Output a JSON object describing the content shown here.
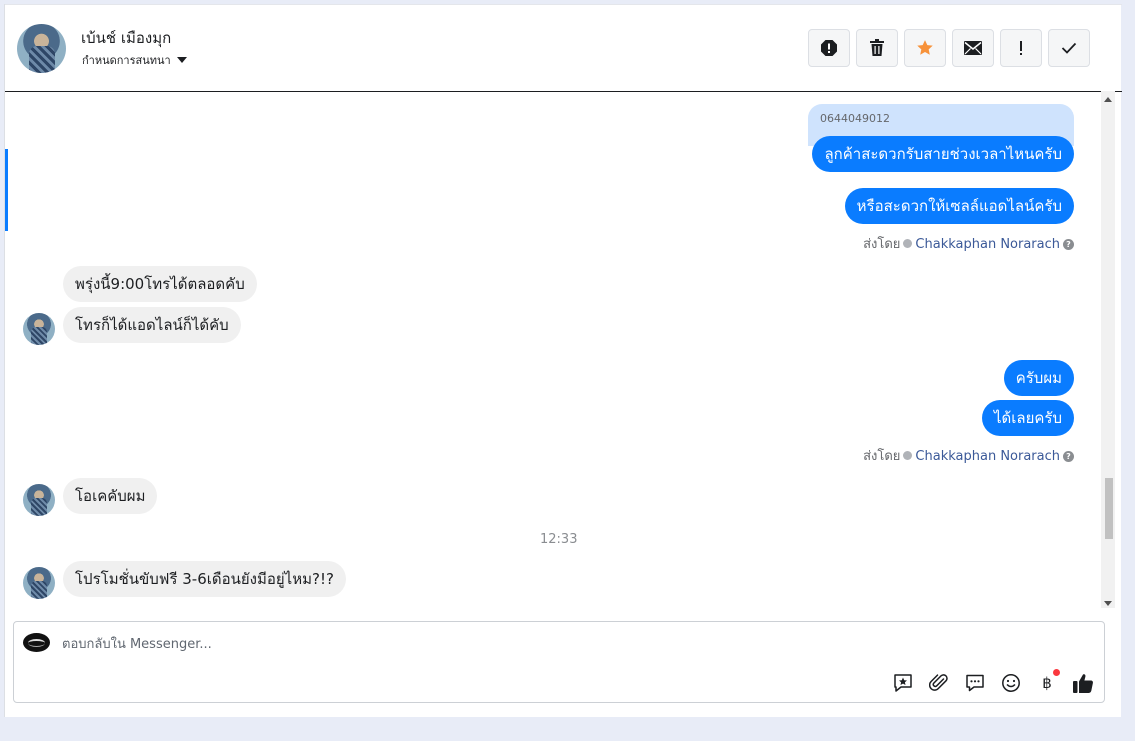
{
  "header": {
    "contact_name": "เบ้นช์ เมืองมุก",
    "assign_label": "กำหนดการสนทนา",
    "actions": [
      {
        "name": "spam-icon"
      },
      {
        "name": "trash-icon"
      },
      {
        "name": "star-icon",
        "color": "#f7923a"
      },
      {
        "name": "mail-icon"
      },
      {
        "name": "follow-up-icon"
      },
      {
        "name": "check-icon"
      }
    ]
  },
  "messages": {
    "quoted_phone": "0644049012",
    "out_1": "ลูกค้าสะดวกรับสายช่วงเวลาไหนครับ",
    "out_2": "หรือสะดวกให้เซลล์แอดไลน์ครับ",
    "sent_by_label_1": "ส่งโดย",
    "agent_1": "Chakkaphan Norarach",
    "in_1": "พรุ่งนี้9:00โทรได้ตลอดคับ",
    "in_2": "โทรก็ได้แอดไลน์ก็ได้คับ",
    "out_3": "ครับผม",
    "out_4": "ได้เลยครับ",
    "sent_by_label_2": "ส่งโดย",
    "agent_2": "Chakkaphan Norarach",
    "in_3": "โอเคคับผม",
    "time": "12:33",
    "in_4": "โปรโมชั่นขับฟรี 3-6เดือนยังมีอยู่ไหม?!?"
  },
  "composer": {
    "placeholder": "ตอบกลับใน Messenger...",
    "value": "",
    "tools": [
      "saved-reply-icon",
      "attachment-icon",
      "chat-icon",
      "emoji-icon",
      "baht-icon",
      "like-icon"
    ],
    "baht_symbol": "฿"
  },
  "colors": {
    "accent": "#0a7cff",
    "incoming": "#f0f0f0",
    "quote": "#cfe3fd"
  }
}
